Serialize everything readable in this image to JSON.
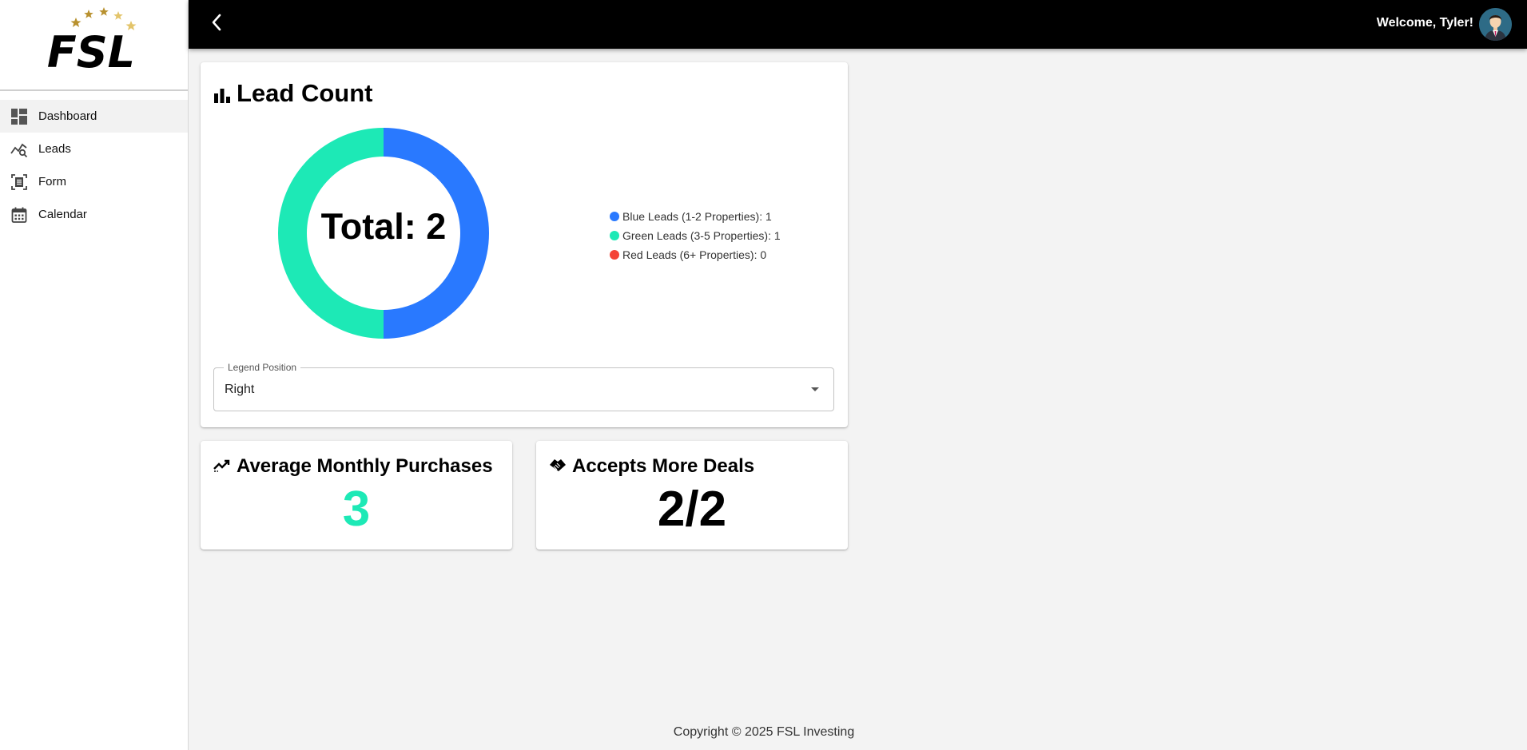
{
  "sidebar": {
    "logo_text": "FSL",
    "items": [
      {
        "label": "Dashboard",
        "icon": "dashboard-icon",
        "active": true
      },
      {
        "label": "Leads",
        "icon": "leads-chart-icon",
        "active": false
      },
      {
        "label": "Form",
        "icon": "form-icon",
        "active": false
      },
      {
        "label": "Calendar",
        "icon": "calendar-icon",
        "active": false
      }
    ]
  },
  "header": {
    "back_icon": "chevron-left-icon",
    "welcome": "Welcome, Tyler!",
    "avatar_icon": "user-avatar"
  },
  "lead_count": {
    "title": "Lead Count",
    "icon": "bar-chart-icon",
    "total_label": "Total: 2",
    "legend": [
      "Blue Leads (1-2 Properties): 1",
      "Green Leads (3-5 Properties): 1",
      "Red Leads (6+ Properties): 0"
    ],
    "legend_position": {
      "label": "Legend Position",
      "value": "Right"
    }
  },
  "chart_data": {
    "type": "pie",
    "variant": "donut",
    "categories": [
      "Blue Leads (1-2 Properties)",
      "Green Leads (3-5 Properties)",
      "Red Leads (6+ Properties)"
    ],
    "values": [
      1,
      1,
      0
    ],
    "colors": [
      "#2979ff",
      "#1de9b6",
      "#f44336"
    ],
    "center_text": "Total: 2",
    "legend_position": "right"
  },
  "avg_monthly": {
    "title": "Average Monthly Purchases",
    "icon": "trending-icon",
    "value": "3",
    "color": "#1de9b6"
  },
  "accepts_deals": {
    "title": "Accepts More Deals",
    "icon": "handshake-icon",
    "value": "2/2"
  },
  "footer": {
    "copyright": "Copyright © 2025 FSL Investing"
  }
}
